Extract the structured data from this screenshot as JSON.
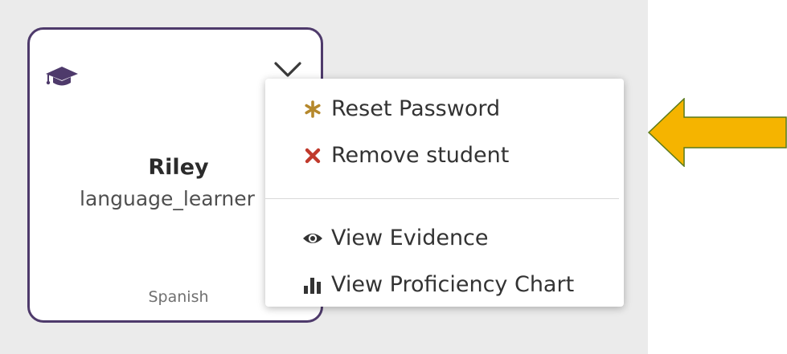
{
  "card": {
    "name": "Riley",
    "username": "language_learner",
    "language": "Spanish",
    "border_color": "#4e3a6b",
    "icons": {
      "role": "graduation-cap-icon",
      "menu_toggle": "chevron-down-icon"
    }
  },
  "menu": {
    "items": [
      {
        "label": "Reset Password",
        "icon": "asterisk-icon",
        "icon_color": "#b5882c"
      },
      {
        "label": "Remove student",
        "icon": "close-x-icon",
        "icon_color": "#c0392b"
      },
      {
        "label": "View Evidence",
        "icon": "eye-icon",
        "icon_color": "#333333"
      },
      {
        "label": "View Proficiency Chart",
        "icon": "bar-chart-icon",
        "icon_color": "#333333"
      }
    ]
  },
  "annotation": {
    "icon": "left-arrow-icon",
    "fill_color": "#f5b400",
    "stroke_color": "#5a7a1a"
  }
}
